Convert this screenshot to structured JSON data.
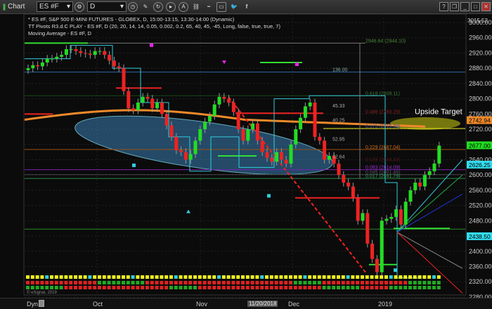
{
  "toolbar": {
    "title": "Chart",
    "symbol": "ES #F",
    "interval": "D",
    "window_buttons": [
      "?",
      "❐",
      "_",
      "□",
      "✕"
    ]
  },
  "info": {
    "line1": "* ES #F, S&P 500 E-MINI FUTURES - GLOBEX, D, 15:00-13:15, 13:30-14:00 (Dynamic)",
    "line2": "TT Pivots R3.d.C PLAY - ES #F, D (20, 20, 14, 14, 0.05, 0.002, 0.2, 65, 40, 45, -45, Long, false, true, true, 7)",
    "line3": "Moving Average - ES #F, D"
  },
  "axis": {
    "ticks": [
      "3000.00",
      "2960.00",
      "2920.00",
      "2880.00",
      "2840.00",
      "2800.00",
      "2760.00",
      "2720.00",
      "2680.00",
      "2640.00",
      "2600.00",
      "2560.00",
      "2520.00",
      "2480.00",
      "2440.00",
      "2400.00",
      "2360.00",
      "2320.00",
      "2280.00"
    ],
    "tick_values": [
      3000,
      2960,
      2920,
      2880,
      2840,
      2800,
      2760,
      2720,
      2680,
      2640,
      2600,
      2560,
      2520,
      2480,
      2440,
      2400,
      2360,
      2320,
      2280
    ],
    "top_price": "3015.52",
    "tags": [
      {
        "label": "2742.94",
        "value": 2742.94,
        "color": "#f08a2a"
      },
      {
        "label": "2677.00",
        "value": 2677,
        "color": "#22dd22"
      },
      {
        "label": "2626.25",
        "value": 2626.25,
        "color": "#33ddee"
      },
      {
        "label": "2438.50",
        "value": 2438.5,
        "color": "#33ddee"
      }
    ]
  },
  "fib_labels": [
    {
      "text": "2946.64 (2944.10)",
      "value": 2946,
      "color": "#4a8a3a"
    },
    {
      "text": "136.00",
      "value": 2870,
      "color": "#8aa"
    },
    {
      "text": "0.618 (2808.11)",
      "value": 2808,
      "color": "#3a7a3a"
    },
    {
      "text": "45.33",
      "value": 2775,
      "color": "#aaa"
    },
    {
      "text": "0.486 (2760.29)",
      "value": 2760,
      "color": "#8a2020"
    },
    {
      "text": "40.25",
      "value": 2738,
      "color": "#aaa"
    },
    {
      "text": "0.375 (2719.98)",
      "value": 2722,
      "color": "#3a5aa0"
    },
    {
      "text": "52.95",
      "value": 2688,
      "color": "#aaa"
    },
    {
      "text": "0.229 (2667.04)",
      "value": 2667,
      "color": "#d07020"
    },
    {
      "text": "32.64",
      "value": 2642,
      "color": "#aaa"
    },
    {
      "text": "0.139 (2634.49)",
      "value": 2634,
      "color": "#501818"
    },
    {
      "text": "0.083 (2614.09)",
      "value": 2614,
      "color": "#9a30d0"
    },
    {
      "text": "0.045 (2601.46)",
      "value": 2601,
      "color": "#556"
    },
    {
      "text": "0.017 (2591.79)",
      "value": 2591,
      "color": "#3a9a5a"
    }
  ],
  "annotation": {
    "upside_target": "Upside Target"
  },
  "candles_close": [
    2880,
    2888,
    2885,
    2895,
    2905,
    2905,
    2910,
    2915,
    2930,
    2930,
    2925,
    2920,
    2918,
    2915,
    2925,
    2925,
    2915,
    2900,
    2885,
    2880,
    2820,
    2775,
    2770,
    2790,
    2805,
    2800,
    2775,
    2790,
    2760,
    2730,
    2700,
    2665,
    2660,
    2640,
    2655,
    2690,
    2720,
    2740,
    2755,
    2785,
    2805,
    2800,
    2790,
    2765,
    2720,
    2690,
    2720,
    2735,
    2690,
    2660,
    2645,
    2635,
    2660,
    2640,
    2630,
    2680,
    2720,
    2750,
    2780,
    2790,
    2700,
    2690,
    2640,
    2650,
    2630,
    2600,
    2580,
    2570,
    2540,
    2480,
    2500,
    2420,
    2380,
    2345,
    2480,
    2485,
    2490,
    2510,
    2470,
    2530,
    2560,
    2580,
    2570,
    2600,
    2610,
    2630,
    2677
  ],
  "time_axis": {
    "dyn": "Dyn",
    "labels": [
      "Oct",
      "Nov",
      "Dec",
      "2019"
    ],
    "cursor_date": "11/20/2018"
  },
  "copyright": "© eSignal, 2019",
  "colors": {
    "up": "#22dd22",
    "down": "#ee2222",
    "ma": "#f08a2a",
    "cyan": "#33ccdd"
  }
}
